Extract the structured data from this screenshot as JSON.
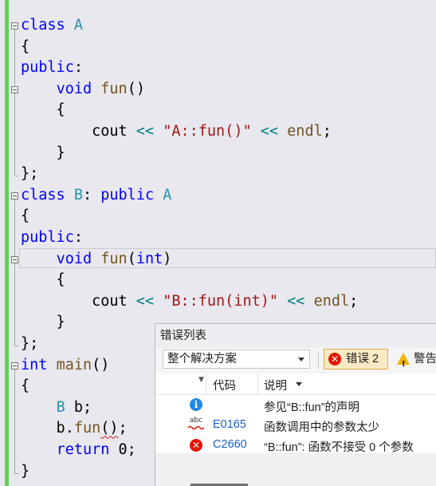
{
  "code": {
    "lines": [
      [
        {
          "t": "class",
          "c": "kw"
        },
        {
          "t": " "
        },
        {
          "t": "A",
          "c": "cls"
        }
      ],
      [
        {
          "t": "{"
        }
      ],
      [
        {
          "t": "public",
          "c": "kw"
        },
        {
          "t": ":"
        }
      ],
      [
        {
          "t": "    "
        },
        {
          "t": "void",
          "c": "kw"
        },
        {
          "t": " "
        },
        {
          "t": "fun",
          "c": "fn"
        },
        {
          "t": "()"
        }
      ],
      [
        {
          "t": "    {"
        }
      ],
      [
        {
          "t": "        cout "
        },
        {
          "t": "<<",
          "c": "op"
        },
        {
          "t": " "
        },
        {
          "t": "\"A::fun()\"",
          "c": "str"
        },
        {
          "t": " "
        },
        {
          "t": "<<",
          "c": "op"
        },
        {
          "t": " "
        },
        {
          "t": "endl",
          "c": "fn"
        },
        {
          "t": ";"
        }
      ],
      [
        {
          "t": "    }"
        }
      ],
      [
        {
          "t": "};"
        }
      ],
      [
        {
          "t": "class",
          "c": "kw"
        },
        {
          "t": " "
        },
        {
          "t": "B",
          "c": "cls"
        },
        {
          "t": ": "
        },
        {
          "t": "public",
          "c": "kw"
        },
        {
          "t": " "
        },
        {
          "t": "A",
          "c": "cls"
        }
      ],
      [
        {
          "t": "{"
        }
      ],
      [
        {
          "t": "public",
          "c": "kw"
        },
        {
          "t": ":"
        }
      ],
      [
        {
          "t": "    "
        },
        {
          "t": "void",
          "c": "kw"
        },
        {
          "t": " "
        },
        {
          "t": "fun",
          "c": "fn"
        },
        {
          "t": "("
        },
        {
          "t": "int",
          "c": "kw"
        },
        {
          "t": ")"
        }
      ],
      [
        {
          "t": "    {"
        }
      ],
      [
        {
          "t": "        cout "
        },
        {
          "t": "<<",
          "c": "op"
        },
        {
          "t": " "
        },
        {
          "t": "\"B::fun(int)\"",
          "c": "str"
        },
        {
          "t": " "
        },
        {
          "t": "<<",
          "c": "op"
        },
        {
          "t": " "
        },
        {
          "t": "endl",
          "c": "fn"
        },
        {
          "t": ";"
        }
      ],
      [
        {
          "t": "    }"
        }
      ],
      [
        {
          "t": "};"
        }
      ],
      [
        {
          "t": "int",
          "c": "kw"
        },
        {
          "t": " "
        },
        {
          "t": "main",
          "c": "fn"
        },
        {
          "t": "()"
        }
      ],
      [
        {
          "t": "{"
        }
      ],
      [
        {
          "t": "    "
        },
        {
          "t": "B",
          "c": "cls"
        },
        {
          "t": " b;"
        }
      ],
      [
        {
          "t": "    b."
        },
        {
          "t": "fun",
          "c": "fn"
        },
        {
          "t": "()",
          "c": "squiggle"
        },
        {
          "t": ";"
        }
      ],
      [
        {
          "t": "    "
        },
        {
          "t": "return",
          "c": "kw"
        },
        {
          "t": " 0;"
        }
      ],
      [
        {
          "t": "}"
        }
      ]
    ]
  },
  "error_list": {
    "title": "错误列表",
    "scope_select": "整个解决方案",
    "errors_button": "错误 2",
    "warnings_button": "警告",
    "columns": {
      "code": "代码",
      "description": "说明"
    },
    "rows": [
      {
        "kind": "info-icon",
        "code": "",
        "description": "参见“B::fun”的声明"
      },
      {
        "kind": "spelling-icon",
        "code": "E0165",
        "description": "函数调用中的参数太少"
      },
      {
        "kind": "error-icon",
        "code": "C2660",
        "description": "“B::fun”: 函数不接受 0 个参数"
      }
    ]
  },
  "colors": {
    "editor_bg": "#e8e8ee",
    "keyword": "#0000ff",
    "type": "#2b91af",
    "function": "#74531f",
    "string": "#a31515",
    "operator": "#008080",
    "change_bar": "#62d05a",
    "error_red": "#e51400",
    "link_blue": "#1a5fc7"
  }
}
